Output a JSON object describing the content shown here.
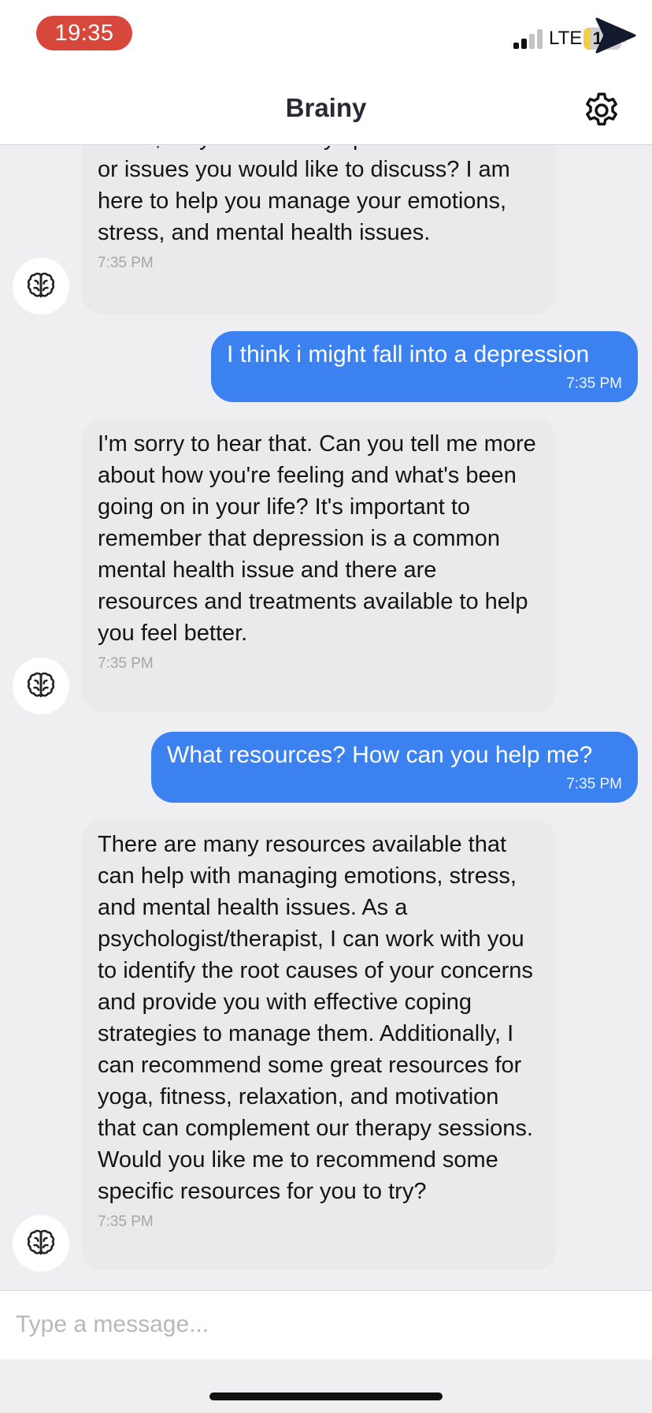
{
  "status_bar": {
    "time": "19:35",
    "network": "LTE",
    "battery_level": "19",
    "battery_fraction": 0.19,
    "signal_bars_active": 2,
    "signal_bars_total": 4
  },
  "header": {
    "title": "Brainy",
    "settings_icon": "gear-icon"
  },
  "messages": [
    {
      "sender": "bot",
      "text": "Great, do you have any specific concerns or issues you would like to discuss? I am here to help you manage your emotions, stress, and mental health issues.",
      "time": "7:35 PM"
    },
    {
      "sender": "user",
      "text": "I think i might fall into a depression",
      "time": "7:35 PM"
    },
    {
      "sender": "bot",
      "text": "I'm sorry to hear that. Can you tell me more about how you're feeling and what's been going on in your life? It's important to remember that depression is a common mental health issue and there are resources and treatments available to help you feel better.",
      "time": "7:35 PM"
    },
    {
      "sender": "user",
      "text": "What resources? How can you help me?",
      "time": "7:35 PM"
    },
    {
      "sender": "bot",
      "text": "There are many resources available that can help with managing emotions, stress, and mental health issues. As a psychologist/therapist, I can work with you to identify the root causes of your concerns and provide you with effective coping strategies to manage them. Additionally, I can recommend some great resources for yoga, fitness, relaxation, and motivation that can complement our therapy sessions. Would you like me to recommend some specific resources for you to try?",
      "time": "7:35 PM"
    }
  ],
  "avatar_icon": "brain-icon",
  "composer": {
    "placeholder": "Type a message...",
    "value": "",
    "send_icon": "send-icon"
  },
  "colors": {
    "user_bubble": "#3b82f0",
    "bot_bubble": "#eaeaec",
    "time_pill": "#d8473b",
    "battery_fill": "#f2cf4a"
  }
}
